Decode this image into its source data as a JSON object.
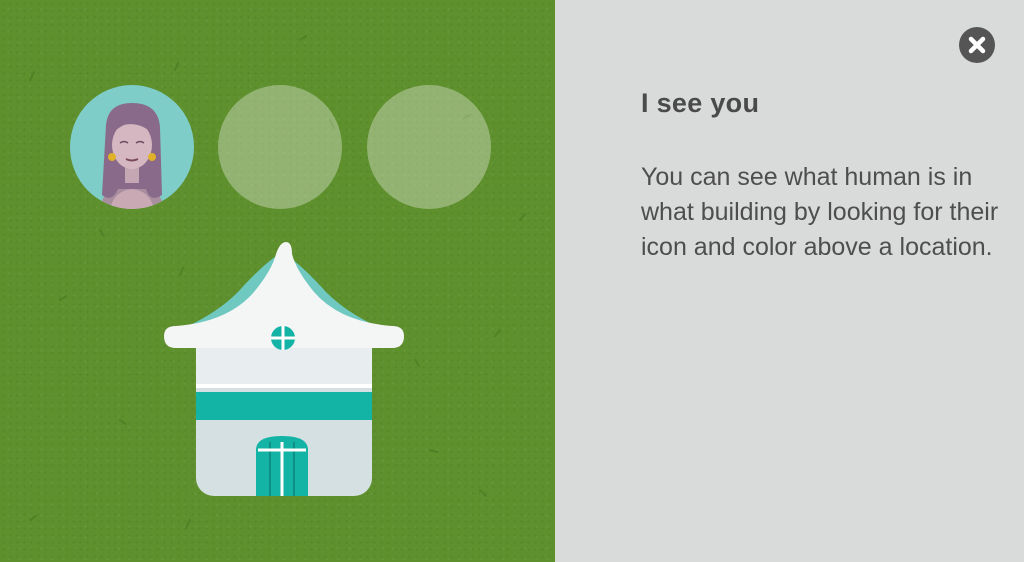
{
  "panel": {
    "title": "I see you",
    "body": "You can see what human is in what building by looking for their icon and color above a location.",
    "close_icon": "close-x-icon"
  },
  "game": {
    "slots": [
      {
        "state": "filled",
        "icon": "woman-avatar-icon"
      },
      {
        "state": "empty"
      },
      {
        "state": "empty"
      }
    ],
    "building_icon": "house-icon"
  },
  "colors": {
    "grass": "#5f902e",
    "panel": "#d9dada",
    "accent": "#13b3a6",
    "avatar_bg": "#7ecdc8",
    "text": "#4a4a4a"
  }
}
